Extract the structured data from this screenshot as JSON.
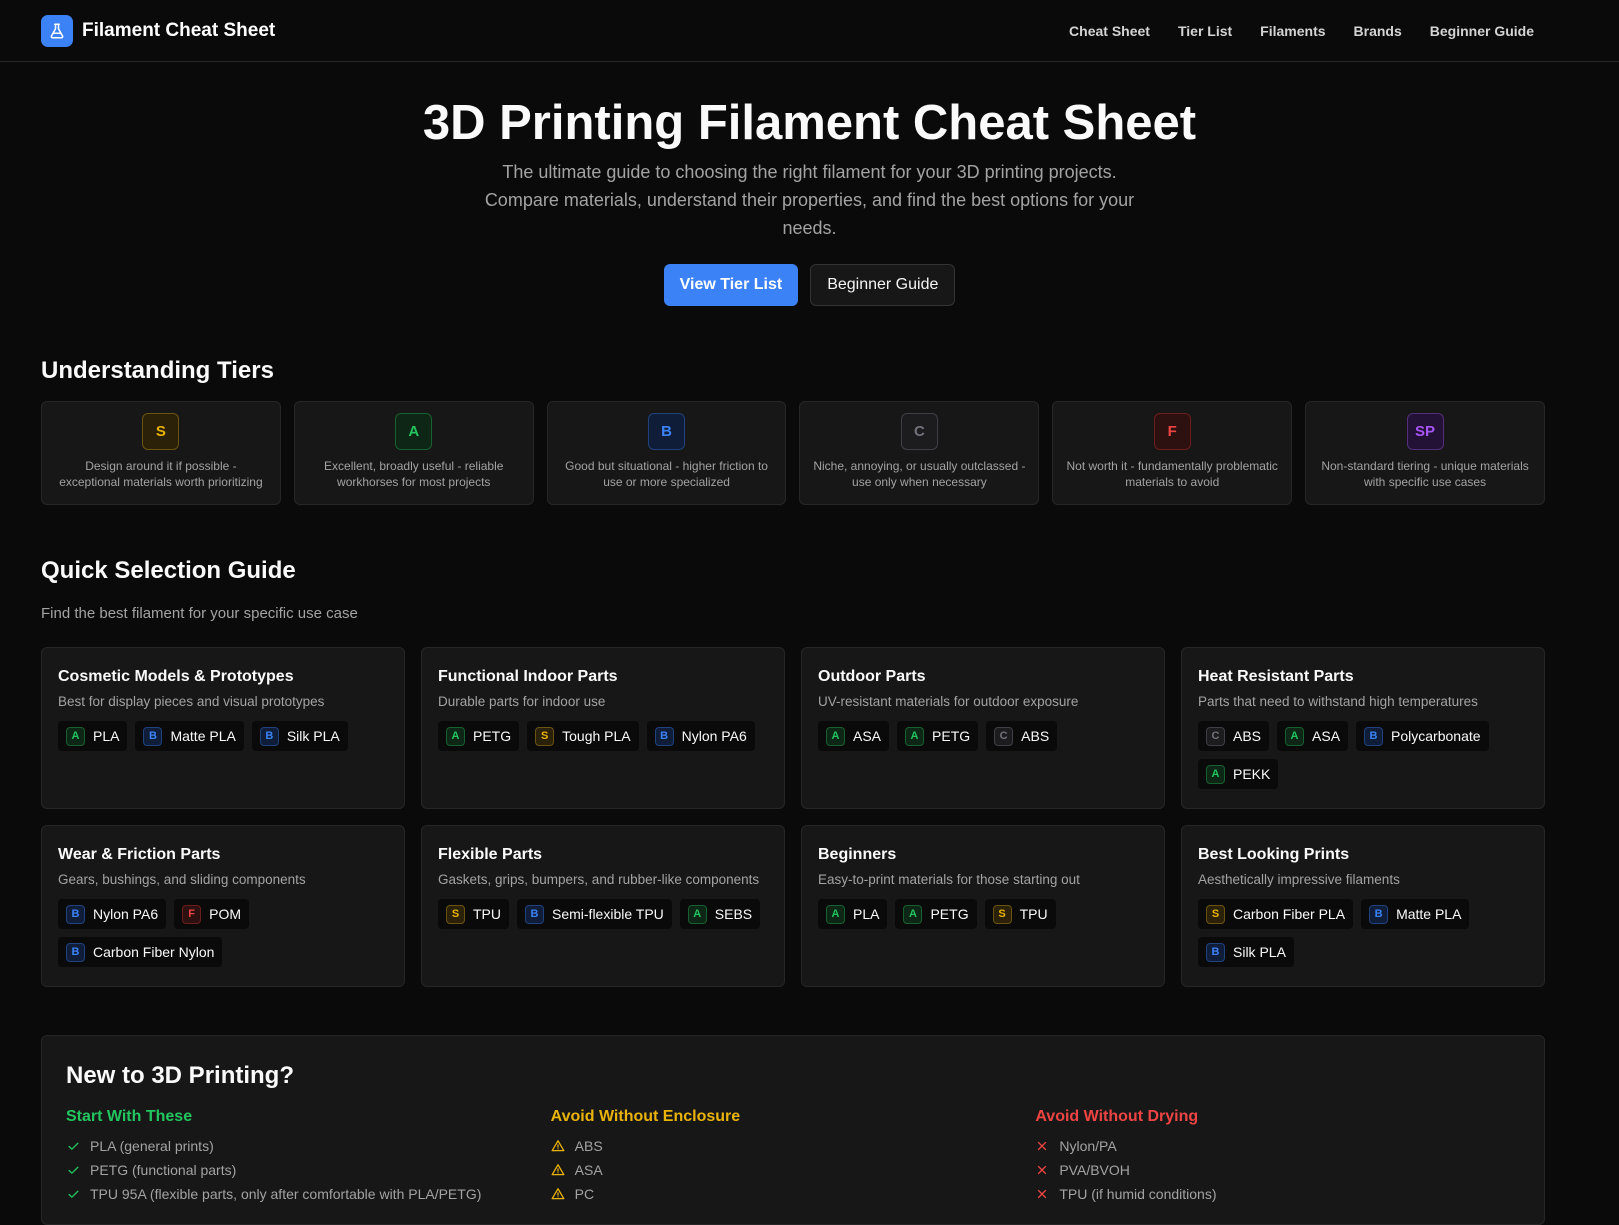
{
  "header": {
    "brand": "Filament Cheat Sheet",
    "nav": [
      "Cheat Sheet",
      "Tier List",
      "Filaments",
      "Brands",
      "Beginner Guide"
    ]
  },
  "hero": {
    "title": "3D Printing Filament Cheat Sheet",
    "subtitle": "The ultimate guide to choosing the right filament for your 3D printing projects. Compare materials, understand their properties, and find the best options for your needs.",
    "primary_button": "View Tier List",
    "secondary_button": "Beginner Guide"
  },
  "tiers": {
    "title": "Understanding Tiers",
    "items": [
      {
        "tier": "S",
        "description": "Design around it if possible - exceptional materials worth prioritizing"
      },
      {
        "tier": "A",
        "description": "Excellent, broadly useful - reliable workhorses for most projects"
      },
      {
        "tier": "B",
        "description": "Good but situational - higher friction to use or more specialized"
      },
      {
        "tier": "C",
        "description": "Niche, annoying, or usually outclassed - use only when necessary"
      },
      {
        "tier": "F",
        "description": "Not worth it - fundamentally problematic materials to avoid"
      },
      {
        "tier": "SP",
        "description": "Non-standard tiering - unique materials with specific use cases"
      }
    ]
  },
  "tier_colors": {
    "S": {
      "fg": "#eab308",
      "bg": "#2a2108",
      "border": "#6b540f"
    },
    "A": {
      "fg": "#22c55e",
      "bg": "#0d2616",
      "border": "#17602f"
    },
    "B": {
      "fg": "#3b82f6",
      "bg": "#0f1d38",
      "border": "#20427d"
    },
    "C": {
      "fg": "#71717a",
      "bg": "#1c1c1f",
      "border": "#3f3f46"
    },
    "F": {
      "fg": "#ef4444",
      "bg": "#2d1010",
      "border": "#6e1d1d"
    },
    "SP": {
      "fg": "#a855f7",
      "bg": "#241236",
      "border": "#52307a"
    }
  },
  "guide": {
    "title": "Quick Selection Guide",
    "subtitle": "Find the best filament for your specific use case",
    "cards": [
      {
        "title": "Cosmetic Models & Prototypes",
        "description": "Best for display pieces and visual prototypes",
        "chips": [
          {
            "tier": "A",
            "label": "PLA"
          },
          {
            "tier": "B",
            "label": "Matte PLA"
          },
          {
            "tier": "B",
            "label": "Silk PLA"
          }
        ]
      },
      {
        "title": "Functional Indoor Parts",
        "description": "Durable parts for indoor use",
        "chips": [
          {
            "tier": "A",
            "label": "PETG"
          },
          {
            "tier": "S",
            "label": "Tough PLA"
          },
          {
            "tier": "B",
            "label": "Nylon PA6"
          }
        ]
      },
      {
        "title": "Outdoor Parts",
        "description": "UV-resistant materials for outdoor exposure",
        "chips": [
          {
            "tier": "A",
            "label": "ASA"
          },
          {
            "tier": "A",
            "label": "PETG"
          },
          {
            "tier": "C",
            "label": "ABS"
          }
        ]
      },
      {
        "title": "Heat Resistant Parts",
        "description": "Parts that need to withstand high temperatures",
        "chips": [
          {
            "tier": "C",
            "label": "ABS"
          },
          {
            "tier": "A",
            "label": "ASA"
          },
          {
            "tier": "B",
            "label": "Polycarbonate"
          },
          {
            "tier": "A",
            "label": "PEKK"
          }
        ]
      },
      {
        "title": "Wear & Friction Parts",
        "description": "Gears, bushings, and sliding components",
        "chips": [
          {
            "tier": "B",
            "label": "Nylon PA6"
          },
          {
            "tier": "F",
            "label": "POM"
          },
          {
            "tier": "B",
            "label": "Carbon Fiber Nylon"
          }
        ]
      },
      {
        "title": "Flexible Parts",
        "description": "Gaskets, grips, bumpers, and rubber-like components",
        "chips": [
          {
            "tier": "S",
            "label": "TPU"
          },
          {
            "tier": "B",
            "label": "Semi-flexible TPU"
          },
          {
            "tier": "A",
            "label": "SEBS"
          }
        ]
      },
      {
        "title": "Beginners",
        "description": "Easy-to-print materials for those starting out",
        "chips": [
          {
            "tier": "A",
            "label": "PLA"
          },
          {
            "tier": "A",
            "label": "PETG"
          },
          {
            "tier": "S",
            "label": "TPU"
          }
        ]
      },
      {
        "title": "Best Looking Prints",
        "description": "Aesthetically impressive filaments",
        "chips": [
          {
            "tier": "S",
            "label": "Carbon Fiber PLA"
          },
          {
            "tier": "B",
            "label": "Matte PLA"
          },
          {
            "tier": "B",
            "label": "Silk PLA"
          }
        ]
      }
    ]
  },
  "newbie": {
    "title": "New to 3D Printing?",
    "columns": [
      {
        "heading": "Start With These",
        "color": "#22c55e",
        "icon": "check-icon",
        "items": [
          "PLA (general prints)",
          "PETG (functional parts)",
          "TPU 95A (flexible parts, only after comfortable with PLA/PETG)"
        ]
      },
      {
        "heading": "Avoid Without Enclosure",
        "color": "#eab308",
        "icon": "warning-icon",
        "items": [
          "ABS",
          "ASA",
          "PC"
        ]
      },
      {
        "heading": "Avoid Without Drying",
        "color": "#ef4444",
        "icon": "x-icon",
        "items": [
          "Nylon/PA",
          "PVA/BVOH",
          "TPU (if humid conditions)"
        ]
      }
    ]
  },
  "icons": {
    "brand_logo": "flask-icon"
  }
}
